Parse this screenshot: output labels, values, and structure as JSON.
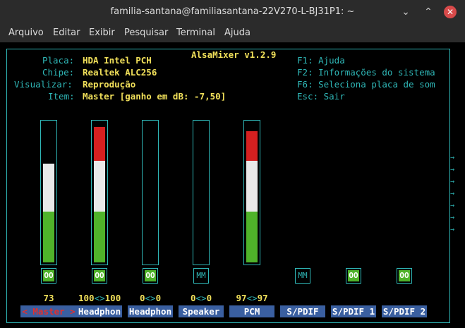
{
  "window": {
    "title": "familia-santana@familiasantana-22V270-L-BJ31P1: ~",
    "minimize": "⌄",
    "maximize": "⌃",
    "close": "✕"
  },
  "menu": [
    "Arquivo",
    "Editar",
    "Exibir",
    "Pesquisar",
    "Terminal",
    "Ajuda"
  ],
  "mixer": {
    "title": "AlsaMixer v1.2.9",
    "info": [
      {
        "label": "Placa:",
        "value": "HDA Intel PCH"
      },
      {
        "label": "Chipe:",
        "value": "Realtek ALC256"
      },
      {
        "label": "Visualizar:",
        "value": "Reprodução"
      },
      {
        "label": "Item:",
        "value": "Master [ganho em dB: -7,50]"
      }
    ],
    "help": [
      "F1:  Ajuda",
      "F2:  Informações do sistema",
      "F6:  Seleciona placa de som",
      "Esc: Sair"
    ],
    "side_arrows": [
      "→",
      "→",
      "→",
      "→",
      "→",
      "→",
      "→"
    ]
  },
  "channels": [
    {
      "name": "Master",
      "selected": true,
      "level": 0.73,
      "switch": "OO",
      "value_left": "73",
      "value_sep": "",
      "value_right": "",
      "has_bar": true
    },
    {
      "name": "Headphon",
      "selected": false,
      "level": 1.0,
      "switch": "OO",
      "value_left": "100",
      "value_sep": "<>",
      "value_right": "100",
      "has_bar": true
    },
    {
      "name": "Headphon",
      "selected": false,
      "level": 0,
      "switch": "OO",
      "value_left": "0",
      "value_sep": "<>",
      "value_right": "0",
      "has_bar": true
    },
    {
      "name": "Speaker",
      "selected": false,
      "level": 0,
      "switch": "MM",
      "value_left": "0",
      "value_sep": "<>",
      "value_right": "0",
      "has_bar": true
    },
    {
      "name": "PCM",
      "selected": false,
      "level": 0.97,
      "switch": "",
      "value_left": "97",
      "value_sep": "<>",
      "value_right": "97",
      "has_bar": true
    },
    {
      "name": "S/PDIF",
      "selected": false,
      "level": 0,
      "switch": "MM",
      "value_left": "",
      "value_sep": "",
      "value_right": "",
      "has_bar": false
    },
    {
      "name": "S/PDIF 1",
      "selected": false,
      "level": 0,
      "switch": "OO",
      "value_left": "",
      "value_sep": "",
      "value_right": "",
      "has_bar": false
    },
    {
      "name": "S/PDIF 2",
      "selected": false,
      "level": 0,
      "switch": "OO",
      "value_left": "",
      "value_sep": "",
      "value_right": "",
      "has_bar": false
    }
  ],
  "colors": {
    "green": "#4fb32a",
    "white": "#e8e8e8",
    "red": "#d42020",
    "cyan": "#2fb7b7",
    "yellow": "#f1e05a",
    "nameBg": "#3a5fa0"
  },
  "selection_markers": {
    "left": "<",
    "right": ">"
  }
}
